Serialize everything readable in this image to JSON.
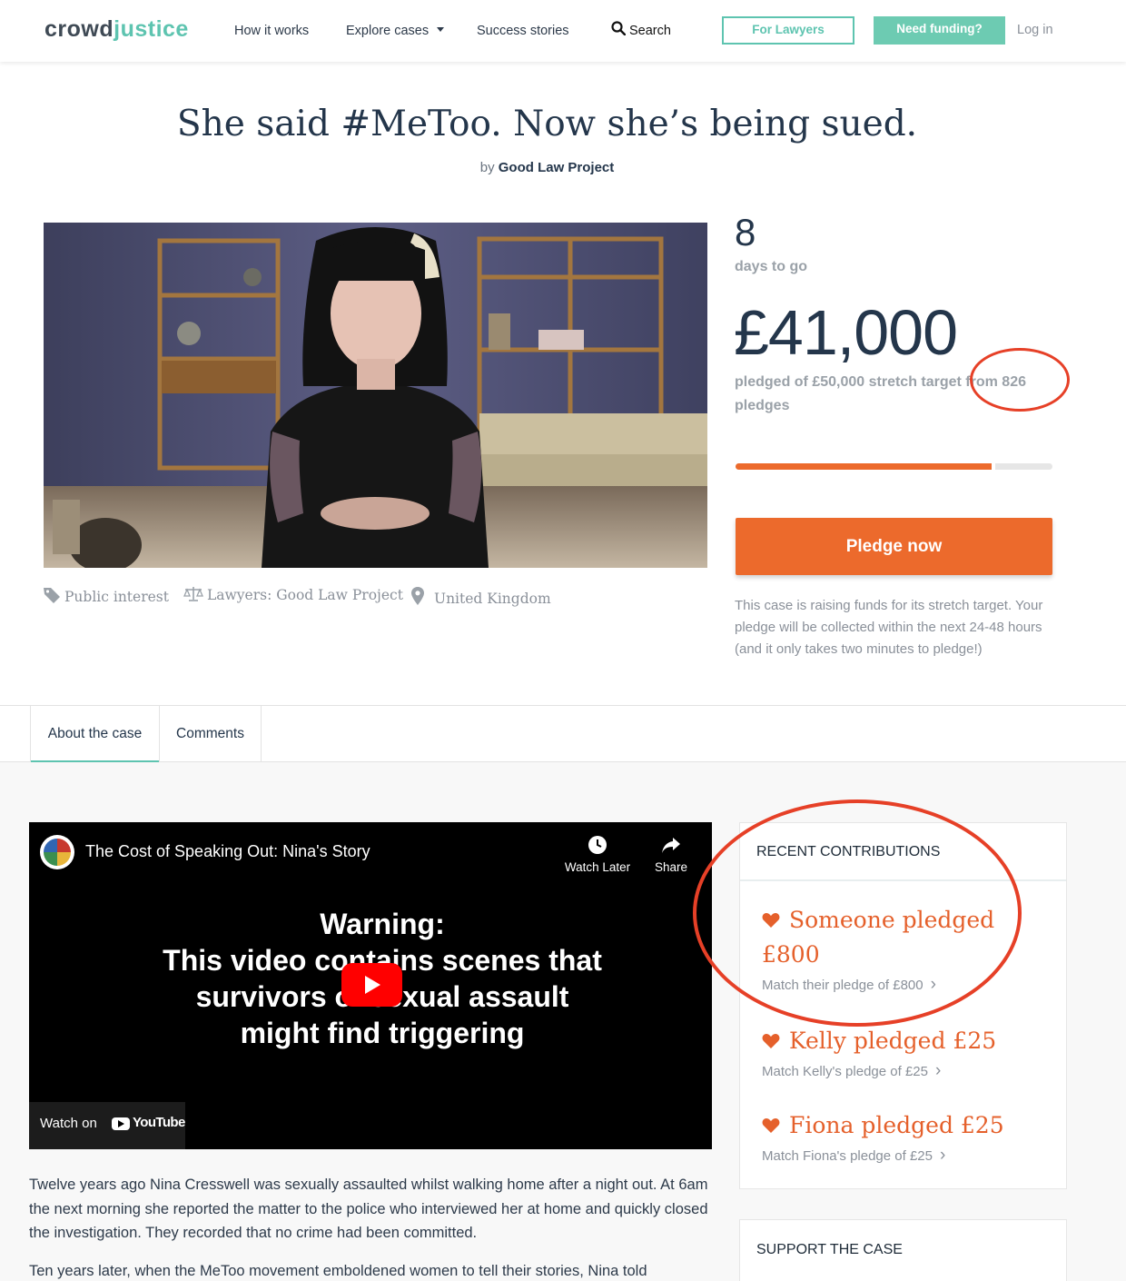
{
  "nav": {
    "logo_part1": "crowd",
    "logo_part2": "justice",
    "links": [
      "How it works",
      "Explore cases",
      "Success stories"
    ],
    "search_label": "Search",
    "for_lawyers": "For Lawyers",
    "need_funding": "Need funding?",
    "login": "Log in"
  },
  "case": {
    "title": "She said #MeToo. Now she’s being sued.",
    "by_prefix": "by",
    "author": "Good Law Project",
    "tags": [
      "Public interest",
      "Lawyers: Good Law Project",
      "United Kingdom"
    ]
  },
  "stats": {
    "days_left": "8",
    "days_label": "days to go",
    "amount": "£41,000",
    "pledged_label": "pledged of £50,000 stretch target from 826 pledges",
    "progress_fraction": 0.82,
    "pledge_button": "Pledge now",
    "note": "This case is raising funds for its stretch target. Your pledge will be collected within the next 24-48 hours (and it only takes two minutes to pledge!)"
  },
  "tabs": [
    "About the case",
    "Comments"
  ],
  "video": {
    "title": "The Cost of Speaking Out: Nina's Story",
    "watch_later": "Watch Later",
    "share": "Share",
    "warning_heading": "Warning:",
    "warning_lines": [
      "This video contains scenes that",
      "survivors of sexual assault",
      "might find triggering"
    ],
    "watch_on": "Watch on",
    "youtube": "YouTube"
  },
  "body": {
    "p1": "Twelve years ago Nina Cresswell was sexually assaulted whilst walking home after a night out. At 6am the next morning she reported the matter to the police who interviewed her at home and quickly closed the investigation. They recorded that no crime had been committed.",
    "p2": "Ten years later, when the MeToo movement emboldened women to tell their stories, Nina told"
  },
  "contributions": {
    "heading": "RECENT CONTRIBUTIONS",
    "items": [
      {
        "headline": "Someone pledged £800",
        "match": "Match their pledge of £800"
      },
      {
        "headline": "Kelly pledged £25",
        "match": "Match Kelly's pledge of £25"
      },
      {
        "headline": "Fiona pledged £25",
        "match": "Match Fiona's pledge of £25"
      }
    ]
  },
  "support_heading": "SUPPORT THE CASE",
  "colors": {
    "accent_teal": "#5ec4b0",
    "accent_orange": "#ec6a2c",
    "navy": "#24364b",
    "annotation_red": "#e64027"
  }
}
